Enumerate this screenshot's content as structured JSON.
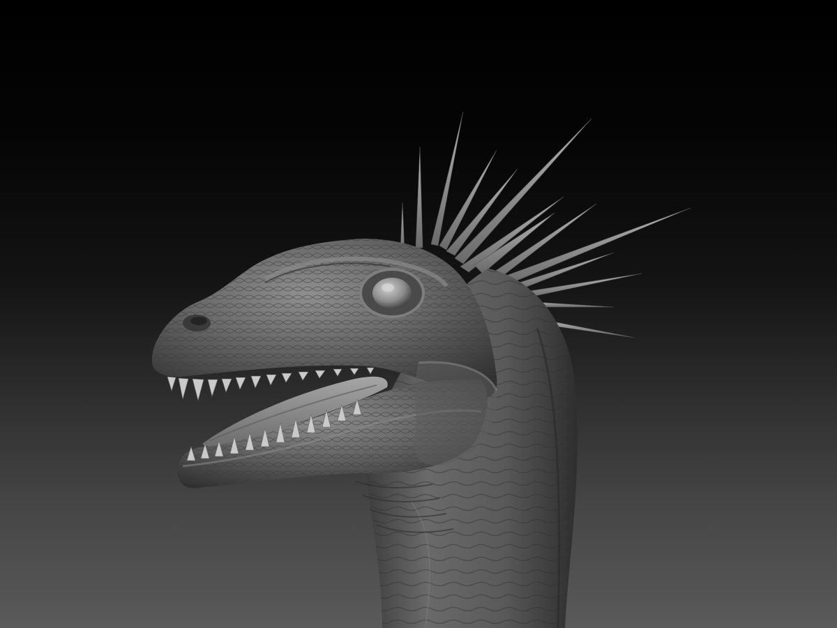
{
  "scene": {
    "subject_icon": "dinosaur-sculpt",
    "render_style": "clay-sculpt-grayscale",
    "colors": {
      "background_top": "#000000",
      "background_bottom": "#5a5a5a",
      "clay_base": "#5e5e5e",
      "clay_highlight": "#9c9c9c",
      "clay_shadow": "#2a2a2a",
      "teeth": "#c8c8c8",
      "tongue": "#8a8a8a"
    }
  }
}
